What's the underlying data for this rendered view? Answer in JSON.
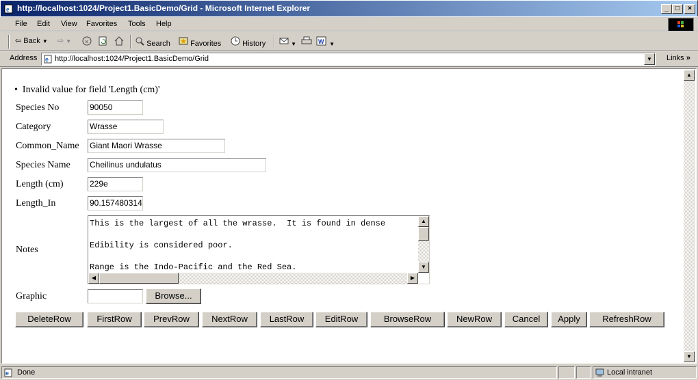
{
  "window": {
    "title": "http://localhost:1024/Project1.BasicDemo/Grid - Microsoft Internet Explorer",
    "controls": [
      "_",
      "□",
      "×"
    ]
  },
  "menu": [
    "File",
    "Edit",
    "View",
    "Favorites",
    "Tools",
    "Help"
  ],
  "toolbar": {
    "back": "Back",
    "search": "Search",
    "favorites": "Favorites",
    "history": "History"
  },
  "address": {
    "label": "Address",
    "url": "http://localhost:1024/Project1.BasicDemo/Grid",
    "links": "Links"
  },
  "form": {
    "error": "Invalid value for field 'Length (cm)'",
    "fields": {
      "species_no": {
        "label": "Species No",
        "value": "90050"
      },
      "category": {
        "label": "Category",
        "value": "Wrasse"
      },
      "common_name": {
        "label": "Common_Name",
        "value": "Giant Maori Wrasse"
      },
      "species_name": {
        "label": "Species Name",
        "value": "Cheilinus undulatus"
      },
      "length_cm": {
        "label": "Length (cm)",
        "value": "229e"
      },
      "length_in": {
        "label": "Length_In",
        "value": "90.157480314"
      },
      "notes": {
        "label": "Notes",
        "value": "This is the largest of all the wrasse.  It is found in dense\n\nEdibility is considered poor.\n\nRange is the Indo-Pacific and the Red Sea."
      },
      "graphic": {
        "label": "Graphic",
        "value": "",
        "browse": "Browse..."
      }
    },
    "buttons": [
      "DeleteRow",
      "FirstRow",
      "PrevRow",
      "NextRow",
      "LastRow",
      "EditRow",
      "BrowseRow",
      "NewRow",
      "Cancel",
      "Apply",
      "RefreshRow"
    ]
  },
  "status": {
    "text": "Done",
    "zone": "Local intranet"
  }
}
